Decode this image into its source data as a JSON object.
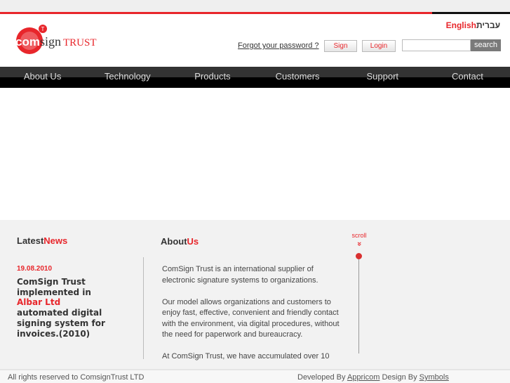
{
  "header": {
    "logo_text_com": "com",
    "logo_text_sign": "sign",
    "logo_text_trust": "TRUST",
    "lang_english": "English",
    "lang_hebrew": "עברית",
    "forgot_password": "Forgot your password ?",
    "sign": "Sign",
    "login": "Login",
    "search_value": "",
    "search_button": "search"
  },
  "nav": [
    "About Us",
    "Technology",
    "Products",
    "Customers",
    "Support",
    "Contact"
  ],
  "news": {
    "title_a": "Latest",
    "title_b": "News",
    "date": "19.08.2010",
    "line1": "ComSign Trust implemented in ",
    "highlight": "Albar Ltd",
    "line2": " automated digital signing system for invoices.(2010)"
  },
  "about": {
    "title_a": "About",
    "title_b": "Us",
    "paragraphs": [
      "ComSign Trust is an international supplier of electronic signature systems to organizations.",
      "Our model allows organizations and customers to enjoy fast, effective, convenient and friendly contact with the environment, via digital procedures, without the need for paperwork and bureaucracy.",
      "At ComSign Trust, we have accumulated over 10"
    ]
  },
  "scroll": {
    "label": "scroll",
    "arrow": "»"
  },
  "footer": {
    "rights": "All rights reserved to ComsignTrust LTD",
    "developed_by": "Developed By ",
    "developer": "Appricom",
    "design_by": " Design By ",
    "designer": "Symbols"
  }
}
